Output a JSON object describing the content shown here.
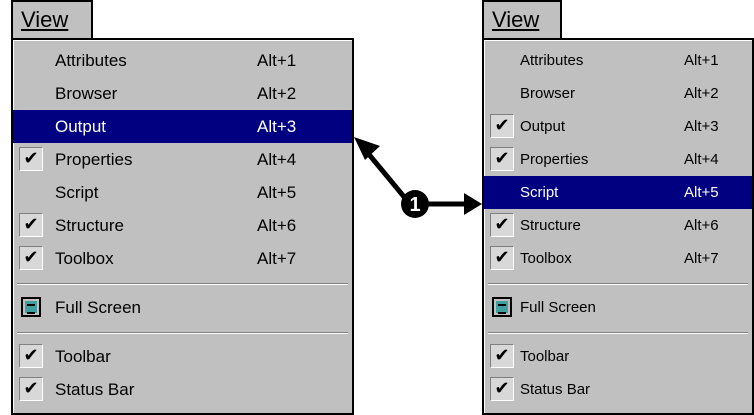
{
  "left_menu": {
    "title": "View",
    "items": [
      {
        "label": "Attributes",
        "shortcut": "Alt+1",
        "checked": false,
        "selected": false
      },
      {
        "label": "Browser",
        "shortcut": "Alt+2",
        "checked": false,
        "selected": false
      },
      {
        "label": "Output",
        "shortcut": "Alt+3",
        "checked": false,
        "selected": true
      },
      {
        "label": "Properties",
        "shortcut": "Alt+4",
        "checked": true,
        "selected": false
      },
      {
        "label": "Script",
        "shortcut": "Alt+5",
        "checked": false,
        "selected": false
      },
      {
        "label": "Structure",
        "shortcut": "Alt+6",
        "checked": true,
        "selected": false
      },
      {
        "label": "Toolbox",
        "shortcut": "Alt+7",
        "checked": true,
        "selected": false
      }
    ],
    "full_screen": "Full Screen",
    "bottom_items": [
      {
        "label": "Toolbar",
        "checked": true
      },
      {
        "label": "Status Bar",
        "checked": true
      }
    ]
  },
  "right_menu": {
    "title": "View",
    "items": [
      {
        "label": "Attributes",
        "shortcut": "Alt+1",
        "checked": false,
        "selected": false
      },
      {
        "label": "Browser",
        "shortcut": "Alt+2",
        "checked": false,
        "selected": false
      },
      {
        "label": "Output",
        "shortcut": "Alt+3",
        "checked": true,
        "selected": false
      },
      {
        "label": "Properties",
        "shortcut": "Alt+4",
        "checked": true,
        "selected": false
      },
      {
        "label": "Script",
        "shortcut": "Alt+5",
        "checked": false,
        "selected": true
      },
      {
        "label": "Structure",
        "shortcut": "Alt+6",
        "checked": true,
        "selected": false
      },
      {
        "label": "Toolbox",
        "shortcut": "Alt+7",
        "checked": true,
        "selected": false
      }
    ],
    "full_screen": "Full Screen",
    "bottom_items": [
      {
        "label": "Toolbar",
        "checked": true
      },
      {
        "label": "Status Bar",
        "checked": true
      }
    ]
  },
  "annotation": {
    "step_number": "1"
  },
  "check_glyph": "✔",
  "colors": {
    "menu_bg": "#c0c0c0",
    "highlight": "#000080",
    "highlight_text": "#ffffff"
  }
}
